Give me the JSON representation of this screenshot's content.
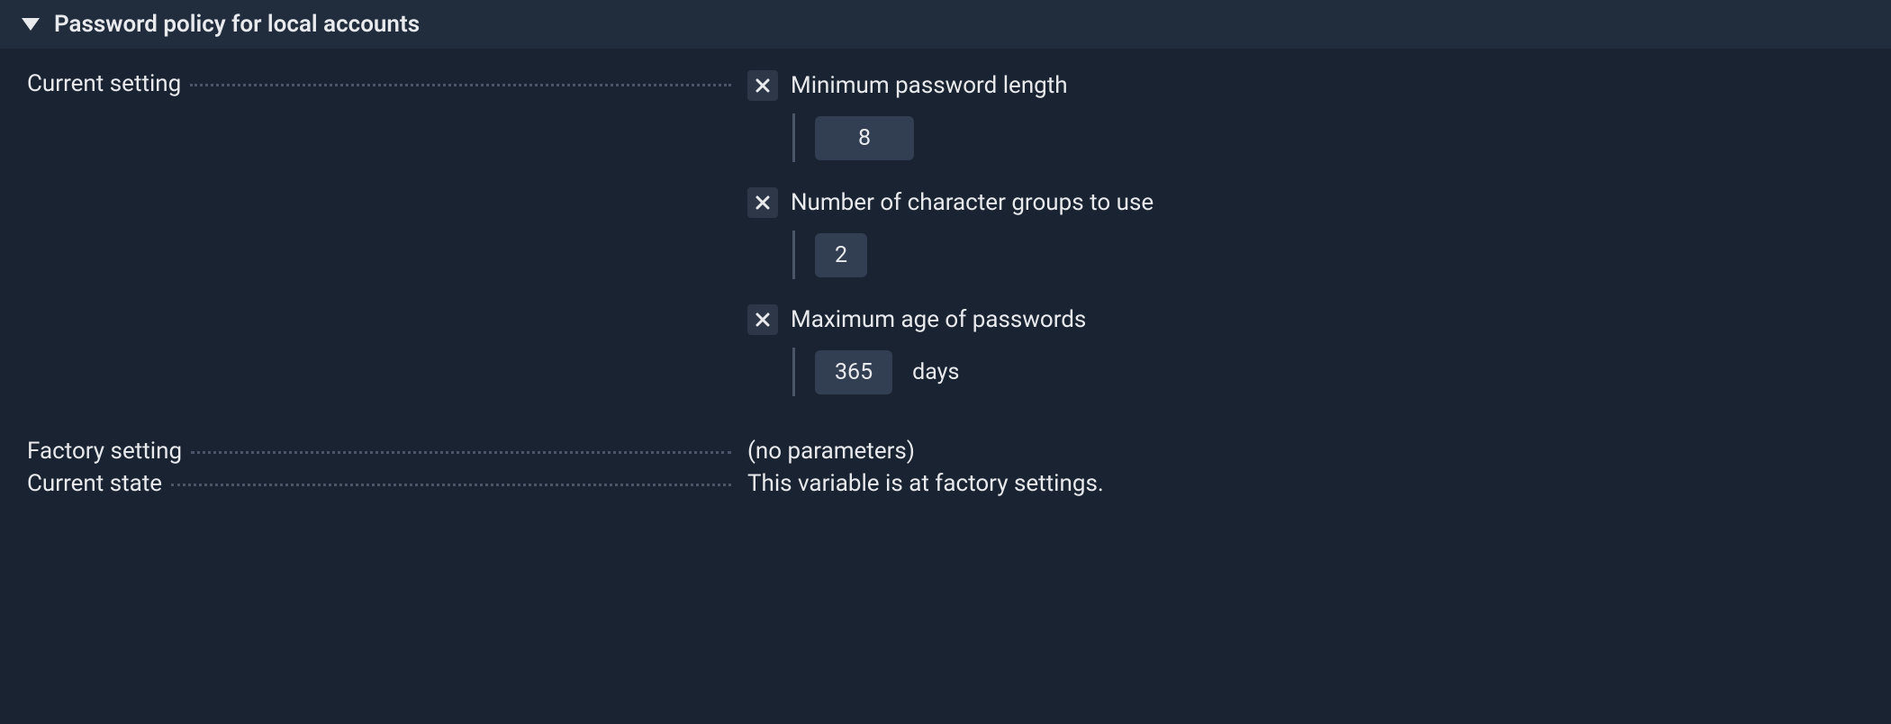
{
  "section": {
    "title": "Password policy for local accounts"
  },
  "current_setting": {
    "label": "Current setting",
    "items": [
      {
        "title": "Minimum password length",
        "value": "8",
        "unit": ""
      },
      {
        "title": "Number of character groups to use",
        "value": "2",
        "unit": ""
      },
      {
        "title": "Maximum age of passwords",
        "value": "365",
        "unit": "days"
      }
    ]
  },
  "factory_setting": {
    "label": "Factory setting",
    "value": "(no parameters)"
  },
  "current_state": {
    "label": "Current state",
    "value": "This variable is at factory settings."
  }
}
